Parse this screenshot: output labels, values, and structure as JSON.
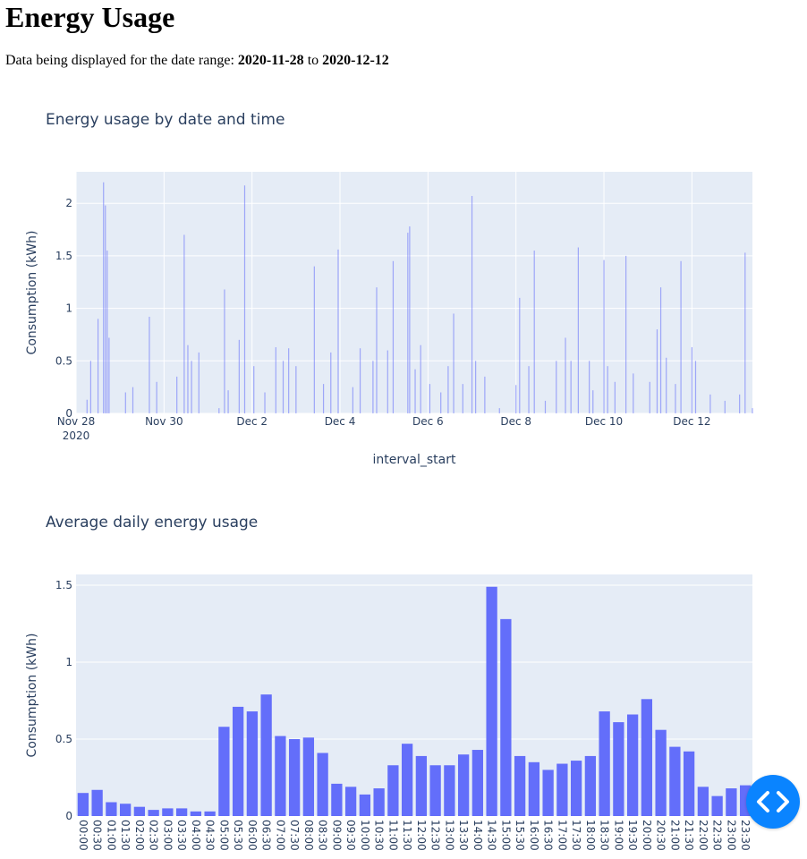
{
  "page": {
    "title": "Energy Usage",
    "range_prefix": "Data being displayed for the date range:",
    "range_start": "2020-11-28",
    "range_connector": "to",
    "range_end": "2020-12-12"
  },
  "colors": {
    "bar": "#636efa",
    "plot_bg": "#e5ecf6",
    "text": "#2a3f5f",
    "fab": "#0a84ff"
  },
  "nav_button": {
    "icon": "code-brackets-icon"
  },
  "chart_data": [
    {
      "type": "bar",
      "title": "Energy usage by date and time",
      "xlabel": "interval_start",
      "ylabel": "Consumption (kWh)",
      "x_axis_type": "date",
      "xlim": [
        "2020-11-28",
        "2020-12-13 09:00"
      ],
      "ylim": [
        0,
        2.3
      ],
      "y_ticks": [
        0,
        0.5,
        1,
        1.5,
        2
      ],
      "y_tick_labels": [
        "0",
        "0.5",
        "1",
        "1.5",
        "2"
      ],
      "x_ticks": [
        "2020-11-28",
        "2020-11-30",
        "2020-12-02",
        "2020-12-04",
        "2020-12-06",
        "2020-12-08",
        "2020-12-10",
        "2020-12-12"
      ],
      "x_tick_labels": [
        "Nov 28",
        "Nov 30",
        "Dec 2",
        "Dec 4",
        "Dec 6",
        "Dec 8",
        "Dec 10",
        "Dec 12"
      ],
      "x_tick_sublabel": "2020",
      "grid": true,
      "series": [
        {
          "values": [
            {
              "x": "2020-11-28 06:00",
              "y": 0.13
            },
            {
              "x": "2020-11-28 08:00",
              "y": 0.5
            },
            {
              "x": "2020-11-28 12:00",
              "y": 0.9
            },
            {
              "x": "2020-11-28 15:00",
              "y": 2.2
            },
            {
              "x": "2020-11-28 16:00",
              "y": 1.98
            },
            {
              "x": "2020-11-28 17:00",
              "y": 1.55
            },
            {
              "x": "2020-11-28 18:00",
              "y": 0.72
            },
            {
              "x": "2020-11-29 03:00",
              "y": 0.2
            },
            {
              "x": "2020-11-29 07:00",
              "y": 0.25
            },
            {
              "x": "2020-11-29 16:00",
              "y": 0.92
            },
            {
              "x": "2020-11-29 20:00",
              "y": 0.3
            },
            {
              "x": "2020-11-30 07:00",
              "y": 0.35
            },
            {
              "x": "2020-11-30 11:00",
              "y": 1.7
            },
            {
              "x": "2020-11-30 13:00",
              "y": 0.65
            },
            {
              "x": "2020-11-30 15:00",
              "y": 0.5
            },
            {
              "x": "2020-11-30 19:00",
              "y": 0.58
            },
            {
              "x": "2020-12-01 06:00",
              "y": 0.05
            },
            {
              "x": "2020-12-01 09:00",
              "y": 1.18
            },
            {
              "x": "2020-12-01 11:00",
              "y": 0.22
            },
            {
              "x": "2020-12-01 17:00",
              "y": 0.7
            },
            {
              "x": "2020-12-01 20:00",
              "y": 2.17
            },
            {
              "x": "2020-12-02 01:00",
              "y": 0.45
            },
            {
              "x": "2020-12-02 07:00",
              "y": 0.2
            },
            {
              "x": "2020-12-02 13:00",
              "y": 0.63
            },
            {
              "x": "2020-12-02 17:00",
              "y": 0.5
            },
            {
              "x": "2020-12-02 20:00",
              "y": 0.62
            },
            {
              "x": "2020-12-03 00:00",
              "y": 0.45
            },
            {
              "x": "2020-12-03 10:00",
              "y": 1.4
            },
            {
              "x": "2020-12-03 15:00",
              "y": 0.28
            },
            {
              "x": "2020-12-03 19:00",
              "y": 0.58
            },
            {
              "x": "2020-12-03 23:00",
              "y": 1.56
            },
            {
              "x": "2020-12-04 07:00",
              "y": 0.25
            },
            {
              "x": "2020-12-04 11:00",
              "y": 0.62
            },
            {
              "x": "2020-12-04 18:00",
              "y": 0.5
            },
            {
              "x": "2020-12-04 20:00",
              "y": 1.2
            },
            {
              "x": "2020-12-05 02:00",
              "y": 0.6
            },
            {
              "x": "2020-12-05 05:00",
              "y": 1.45
            },
            {
              "x": "2020-12-05 13:00",
              "y": 1.72
            },
            {
              "x": "2020-12-05 14:00",
              "y": 1.78
            },
            {
              "x": "2020-12-05 17:00",
              "y": 0.42
            },
            {
              "x": "2020-12-05 20:00",
              "y": 0.65
            },
            {
              "x": "2020-12-06 01:00",
              "y": 0.28
            },
            {
              "x": "2020-12-06 07:00",
              "y": 0.2
            },
            {
              "x": "2020-12-06 11:00",
              "y": 0.45
            },
            {
              "x": "2020-12-06 14:00",
              "y": 0.95
            },
            {
              "x": "2020-12-06 19:00",
              "y": 0.28
            },
            {
              "x": "2020-12-07 00:00",
              "y": 2.07
            },
            {
              "x": "2020-12-07 02:00",
              "y": 0.5
            },
            {
              "x": "2020-12-07 07:00",
              "y": 0.35
            },
            {
              "x": "2020-12-07 15:00",
              "y": 0.05
            },
            {
              "x": "2020-12-08 00:00",
              "y": 0.27
            },
            {
              "x": "2020-12-08 02:00",
              "y": 1.1
            },
            {
              "x": "2020-12-08 07:00",
              "y": 0.45
            },
            {
              "x": "2020-12-08 10:00",
              "y": 1.55
            },
            {
              "x": "2020-12-08 16:00",
              "y": 0.12
            },
            {
              "x": "2020-12-08 22:00",
              "y": 0.5
            },
            {
              "x": "2020-12-09 03:00",
              "y": 0.72
            },
            {
              "x": "2020-12-09 06:00",
              "y": 0.5
            },
            {
              "x": "2020-12-09 10:00",
              "y": 1.58
            },
            {
              "x": "2020-12-09 16:00",
              "y": 0.5
            },
            {
              "x": "2020-12-09 18:00",
              "y": 0.22
            },
            {
              "x": "2020-12-10 00:00",
              "y": 1.46
            },
            {
              "x": "2020-12-10 02:00",
              "y": 0.45
            },
            {
              "x": "2020-12-10 06:00",
              "y": 0.3
            },
            {
              "x": "2020-12-10 12:00",
              "y": 1.5
            },
            {
              "x": "2020-12-10 16:00",
              "y": 0.38
            },
            {
              "x": "2020-12-11 01:00",
              "y": 0.3
            },
            {
              "x": "2020-12-11 05:00",
              "y": 0.8
            },
            {
              "x": "2020-12-11 07:00",
              "y": 1.2
            },
            {
              "x": "2020-12-11 10:00",
              "y": 0.53
            },
            {
              "x": "2020-12-11 15:00",
              "y": 0.28
            },
            {
              "x": "2020-12-11 18:00",
              "y": 1.45
            },
            {
              "x": "2020-12-12 00:00",
              "y": 0.63
            },
            {
              "x": "2020-12-12 02:00",
              "y": 0.5
            },
            {
              "x": "2020-12-12 10:00",
              "y": 0.18
            },
            {
              "x": "2020-12-12 18:00",
              "y": 0.12
            },
            {
              "x": "2020-12-13 02:00",
              "y": 0.18
            },
            {
              "x": "2020-12-13 05:00",
              "y": 1.53
            },
            {
              "x": "2020-12-13 09:00",
              "y": 0.05
            }
          ]
        }
      ]
    },
    {
      "type": "bar",
      "title": "Average daily energy usage",
      "xlabel": "",
      "ylabel": "Consumption (kWh)",
      "ylim": [
        0,
        1.57
      ],
      "y_ticks": [
        0,
        0.5,
        1,
        1.5
      ],
      "y_tick_labels": [
        "0",
        "0.5",
        "1",
        "1.5"
      ],
      "grid": true,
      "categories": [
        "00:00",
        "00:30",
        "01:00",
        "01:30",
        "02:00",
        "02:30",
        "03:00",
        "03:30",
        "04:00",
        "04:30",
        "05:00",
        "05:30",
        "06:00",
        "06:30",
        "07:00",
        "07:30",
        "08:00",
        "08:30",
        "09:00",
        "09:30",
        "10:00",
        "10:30",
        "11:00",
        "11:30",
        "12:00",
        "12:30",
        "13:00",
        "13:30",
        "14:00",
        "14:30",
        "15:00",
        "15:30",
        "16:00",
        "16:30",
        "17:00",
        "17:30",
        "18:00",
        "18:30",
        "19:00",
        "19:30",
        "20:00",
        "20:30",
        "21:00",
        "21:30",
        "22:00",
        "22:30",
        "23:00",
        "23:30"
      ],
      "values": [
        0.15,
        0.17,
        0.09,
        0.08,
        0.06,
        0.04,
        0.05,
        0.05,
        0.03,
        0.03,
        0.58,
        0.71,
        0.68,
        0.79,
        0.52,
        0.5,
        0.51,
        0.41,
        0.21,
        0.19,
        0.14,
        0.18,
        0.33,
        0.47,
        0.39,
        0.33,
        0.33,
        0.4,
        0.43,
        1.49,
        1.28,
        0.39,
        0.35,
        0.3,
        0.34,
        0.36,
        0.39,
        0.68,
        0.61,
        0.66,
        0.76,
        0.56,
        0.45,
        0.42,
        0.19,
        0.13,
        0.18,
        0.2
      ]
    }
  ]
}
